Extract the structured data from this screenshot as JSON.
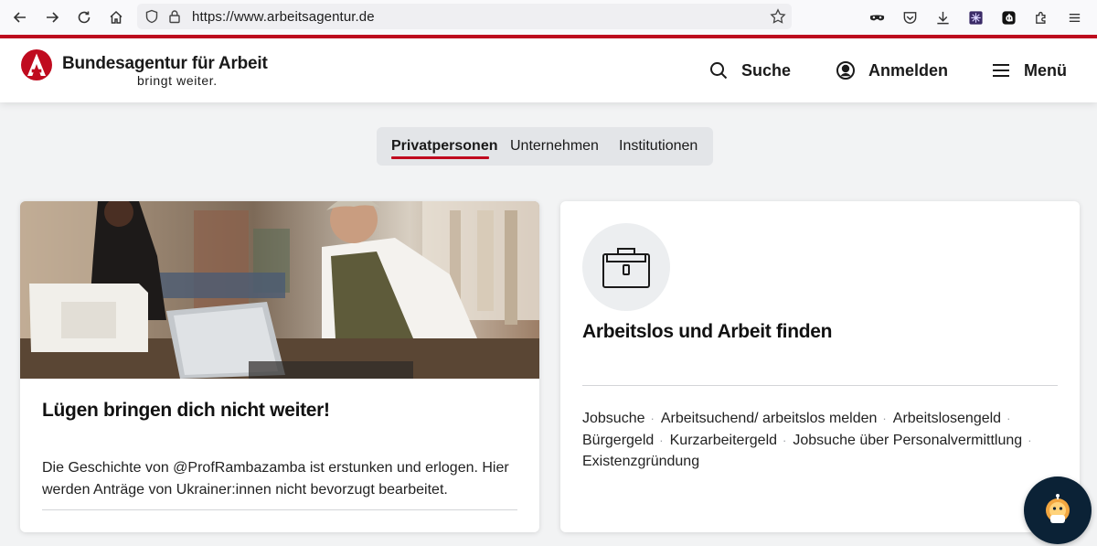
{
  "browser": {
    "url": "https://www.arbeitsagentur.de",
    "icons": [
      "back-icon",
      "forward-icon",
      "reload-icon",
      "home-icon",
      "shield-icon",
      "lock-icon",
      "bookmark-star-icon",
      "mask-icon",
      "pocket-icon",
      "download-icon",
      "extension-grid-icon",
      "extension-badge-icon",
      "extensions-icon",
      "hamburger-icon"
    ]
  },
  "header": {
    "brand_title": "Bundesagentur für Arbeit",
    "brand_subtitle": "bringt weiter.",
    "search_label": "Suche",
    "login_label": "Anmelden",
    "menu_label": "Menü",
    "accent_color": "#c00b1f"
  },
  "tabs": [
    {
      "label": "Privatpersonen",
      "active": true
    },
    {
      "label": "Unternehmen",
      "active": false
    },
    {
      "label": "Institutionen",
      "active": false
    }
  ],
  "cards": {
    "left": {
      "title": "Lügen bringen dich nicht weiter!",
      "body": "Die Geschichte von @ProfRambazamba ist erstunken und erlogen. Hier werden Anträge von Ukrainer:innen nicht bevorzugt bearbeitet."
    },
    "right": {
      "icon": "briefcase-icon",
      "title": "Arbeitslos und Arbeit finden",
      "links": [
        "Jobsuche",
        "Arbeitsuchend/ arbeitslos melden",
        "Arbeitslosengeld",
        "Bürgergeld",
        "Kurzarbeitergeld",
        "Jobsuche über Personalvermittlung",
        "Existenzgründung"
      ],
      "separator": "·"
    }
  },
  "chat": {
    "icon": "chatbot-icon"
  }
}
